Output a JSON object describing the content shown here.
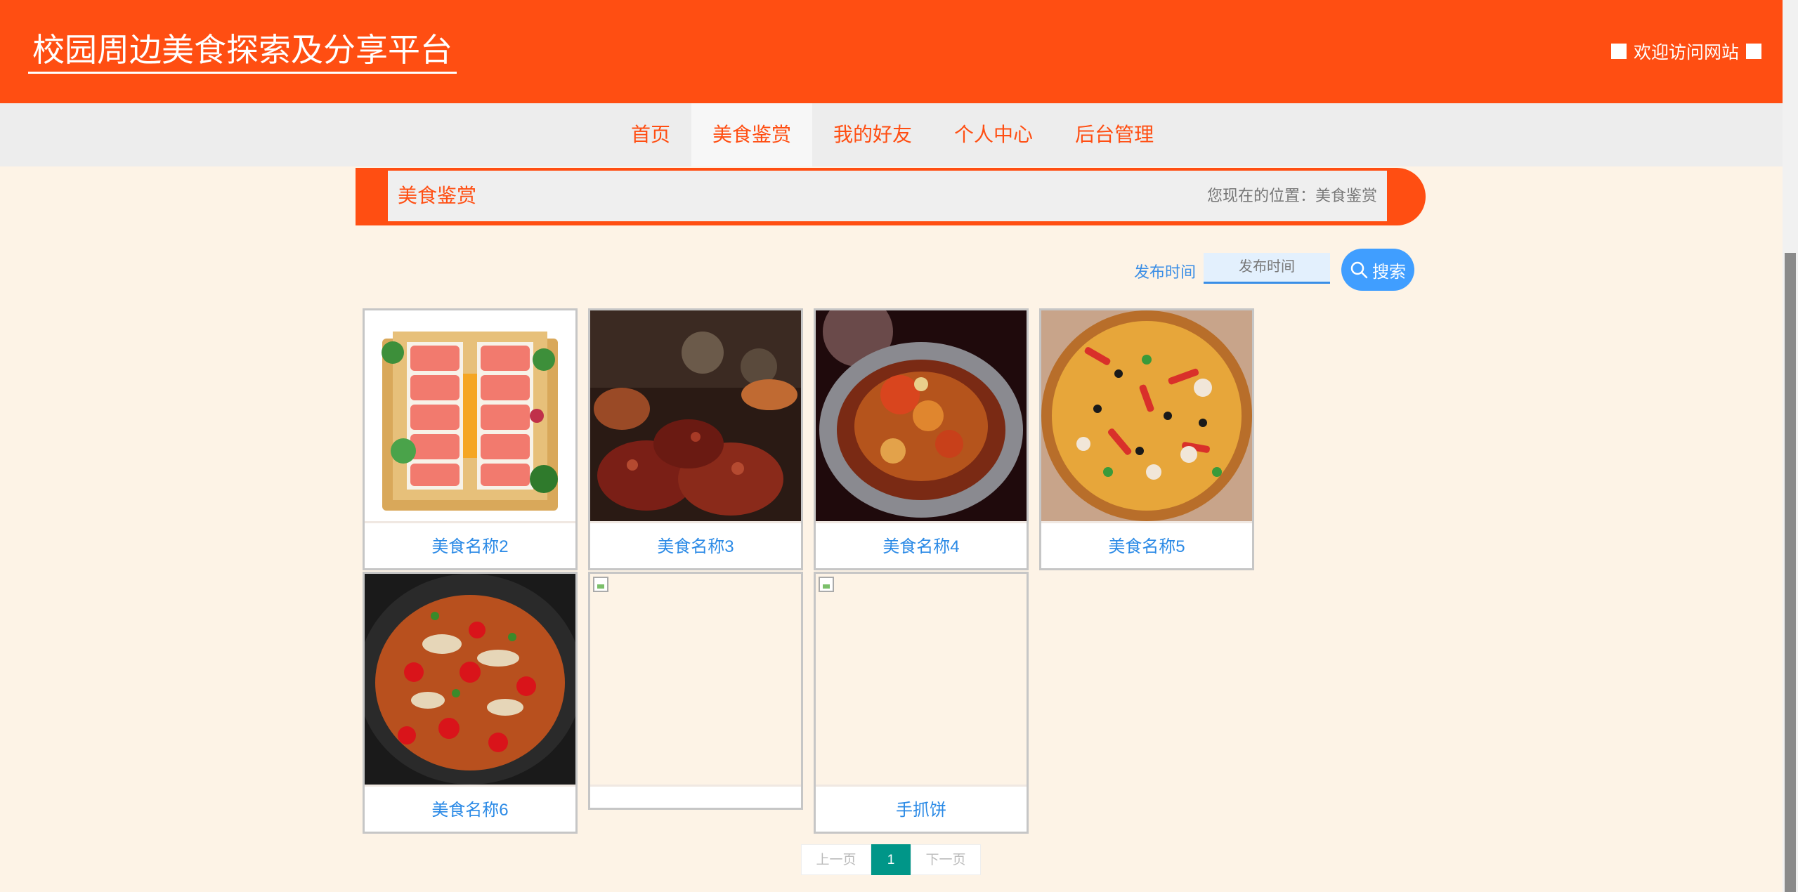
{
  "header": {
    "site_title": "校园周边美食探索及分享平台",
    "welcome": "欢迎访问网站"
  },
  "nav": {
    "items": [
      {
        "label": "首页"
      },
      {
        "label": "美食鉴赏"
      },
      {
        "label": "我的好友"
      },
      {
        "label": "个人中心"
      },
      {
        "label": "后台管理"
      }
    ],
    "active_index": 1
  },
  "breadcrumb": {
    "title": "美食鉴赏",
    "location": "您现在的位置：美食鉴赏"
  },
  "search": {
    "label": "发布时间",
    "placeholder": "发布时间",
    "button_label": "搜索",
    "button_icon": "search-icon"
  },
  "foods": [
    {
      "name": "美食名称2",
      "image": "sashimi-platter"
    },
    {
      "name": "美食名称3",
      "image": "grilled-meat-skewers"
    },
    {
      "name": "美食名称4",
      "image": "crab-pot"
    },
    {
      "name": "美食名称5",
      "image": "pizza"
    },
    {
      "name": "美食名称6",
      "image": "spicy-chicken-stew"
    },
    {
      "name": "",
      "image": "broken-image"
    },
    {
      "name": "手抓饼",
      "image": "broken-image"
    }
  ],
  "pagination": {
    "prev": "上一页",
    "current": "1",
    "next": "下一页"
  },
  "colors": {
    "brand": "#ff4e12",
    "link": "#2b8ae6",
    "button": "#409eff",
    "pager_active": "#009688",
    "page_bg": "#fdf3e6"
  }
}
